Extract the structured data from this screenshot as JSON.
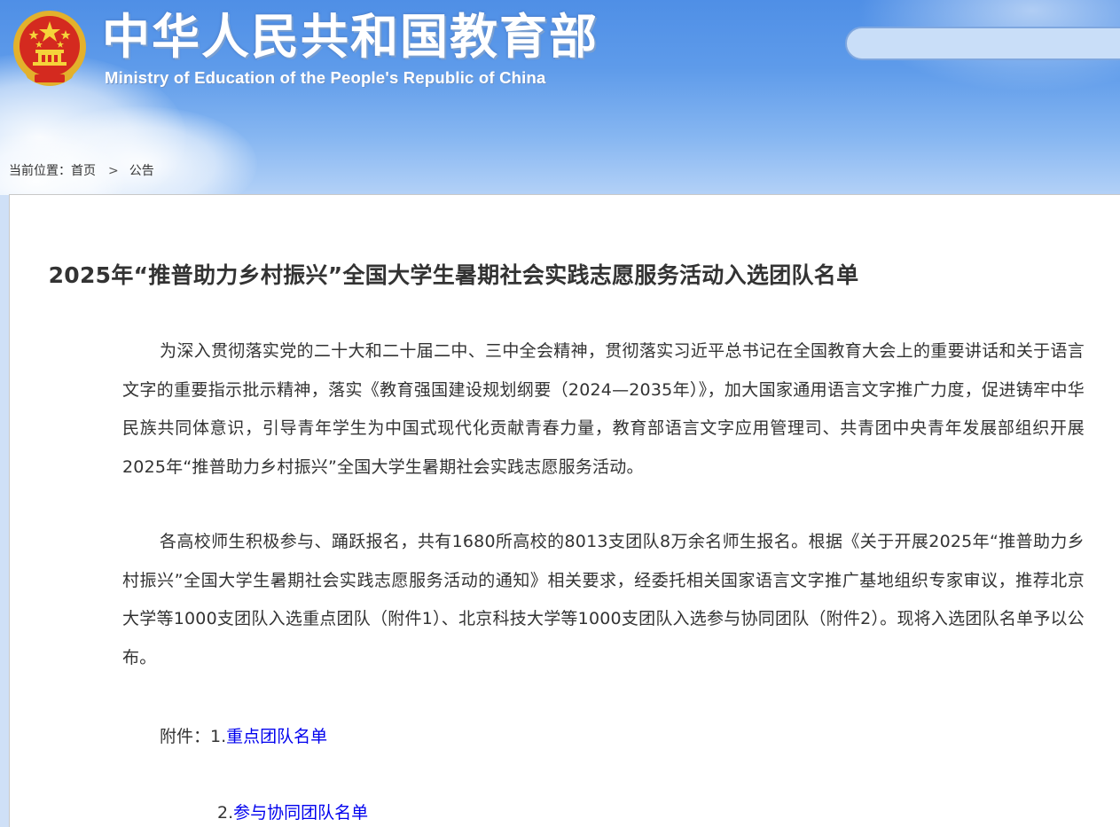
{
  "header": {
    "site_title": "中华人民共和国教育部",
    "site_subtitle": "Ministry of Education of the People's Republic of China",
    "emblem_icon": "national-emblem-icon",
    "search_placeholder": ""
  },
  "breadcrumb": {
    "prefix": "当前位置：",
    "home": "首页",
    "separator": ">",
    "current": "公告"
  },
  "article": {
    "title": "2025年“推普助力乡村振兴”全国大学生暑期社会实践志愿服务活动入选团队名单",
    "paragraphs": [
      "为深入贯彻落实党的二十大和二十届二中、三中全会精神，贯彻落实习近平总书记在全国教育大会上的重要讲话和关于语言文字的重要指示批示精神，落实《教育强国建设规划纲要（2024—2035年）》，加大国家通用语言文字推广力度，促进铸牢中华民族共同体意识，引导青年学生为中国式现代化贡献青春力量，教育部语言文字应用管理司、共青团中央青年发展部组织开展2025年“推普助力乡村振兴”全国大学生暑期社会实践志愿服务活动。",
      "各高校师生积极参与、踊跃报名，共有1680所高校的8013支团队8万余名师生报名。根据《关于开展2025年“推普助力乡村振兴”全国大学生暑期社会实践志愿服务活动的通知》相关要求，经委托相关国家语言文字推广基地组织专家审议，推荐北京大学等1000支团队入选重点团队（附件1）、北京科技大学等1000支团队入选参与协同团队（附件2）。现将入选团队名单予以公布。"
    ],
    "attachments_label": "附件：",
    "attachments": [
      {
        "index": "1.",
        "label": "重点团队名单"
      },
      {
        "index": "2.",
        "label": "参与协同团队名单"
      }
    ]
  },
  "colors": {
    "header_blue": "#5e9bea",
    "link": "#0000ee",
    "text": "#333333"
  }
}
